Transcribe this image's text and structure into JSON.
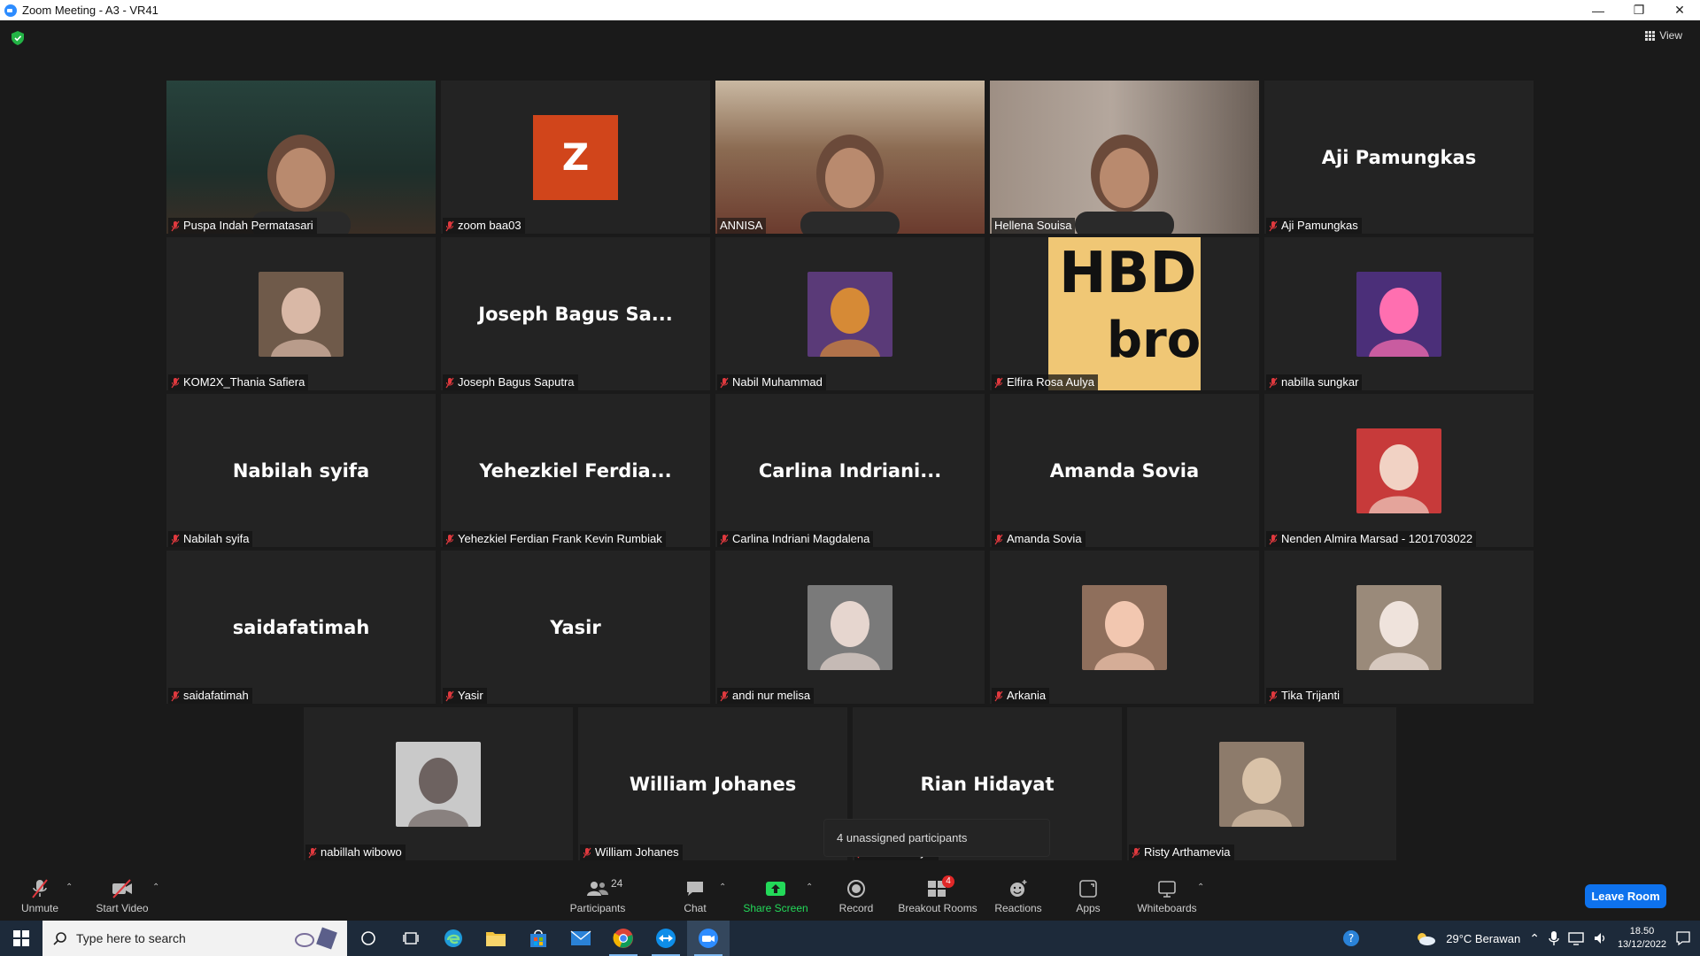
{
  "window": {
    "title": "Zoom Meeting - A3 - VR41"
  },
  "view_button": {
    "label": "View"
  },
  "tiles": [
    {
      "name": "Puspa Indah Permatasari",
      "type": "video"
    },
    {
      "name": "zoom baa03",
      "type": "letter",
      "letter": "Z"
    },
    {
      "name": "ANNISA",
      "type": "video",
      "active": true
    },
    {
      "name": "Hellena Souisa",
      "type": "video"
    },
    {
      "name": "Aji Pamungkas",
      "type": "text",
      "display": "Aji Pamungkas"
    },
    {
      "name": "KOM2X_Thania Safiera",
      "type": "avatar"
    },
    {
      "name": "Joseph Bagus Saputra",
      "type": "text",
      "display": "Joseph Bagus Sa..."
    },
    {
      "name": "Nabil Muhammad",
      "type": "avatar"
    },
    {
      "name": "Elfira Rosa Aulya",
      "type": "hbd",
      "line1": "HBD",
      "line2": "bro"
    },
    {
      "name": "nabilla sungkar",
      "type": "avatar"
    },
    {
      "name": "Nabilah syifa",
      "type": "text",
      "display": "Nabilah syifa"
    },
    {
      "name": "Yehezkiel Ferdian Frank Kevin Rumbiak",
      "type": "text",
      "display": "Yehezkiel  Ferdia..."
    },
    {
      "name": "Carlina Indriani Magdalena",
      "type": "text",
      "display": "Carlina  Indriani..."
    },
    {
      "name": "Amanda Sovia",
      "type": "text",
      "display": "Amanda Sovia"
    },
    {
      "name": "Nenden Almira Marsad - 1201703022",
      "type": "avatar"
    },
    {
      "name": "saidafatimah",
      "type": "text",
      "display": "saidafatimah"
    },
    {
      "name": "Yasir",
      "type": "text",
      "display": "Yasir"
    },
    {
      "name": "andi nur melisa",
      "type": "avatar"
    },
    {
      "name": "Arkania",
      "type": "avatar"
    },
    {
      "name": "Tika Trijanti",
      "type": "avatar"
    },
    {
      "name": "nabillah wibowo",
      "type": "avatar"
    },
    {
      "name": "William Johanes",
      "type": "text",
      "display": "William Johanes"
    },
    {
      "name": "Rian Hidayat",
      "type": "text",
      "display": "Rian Hidayat"
    },
    {
      "name": "Risty Arthamevia",
      "type": "avatar"
    }
  ],
  "unassigned_popup": {
    "text": "4 unassigned participants"
  },
  "toolbar": {
    "unmute": "Unmute",
    "start_video": "Start Video",
    "participants": "Participants",
    "participants_count": "24",
    "chat": "Chat",
    "share_screen": "Share Screen",
    "record": "Record",
    "breakout_rooms": "Breakout Rooms",
    "breakout_badge": "4",
    "reactions": "Reactions",
    "apps": "Apps",
    "whiteboards": "Whiteboards",
    "leave_room": "Leave Room"
  },
  "taskbar": {
    "search_placeholder": "Type here to search",
    "weather": "29°C  Berawan",
    "time": "18.50",
    "date": "13/12/2022"
  },
  "colors": {
    "active_speaker_border": "#f5e87a",
    "share_screen_green": "#23d959",
    "leave_button": "#0e72ed",
    "breakout_badge": "#e02828",
    "muted_mic_red": "#e0393e"
  }
}
